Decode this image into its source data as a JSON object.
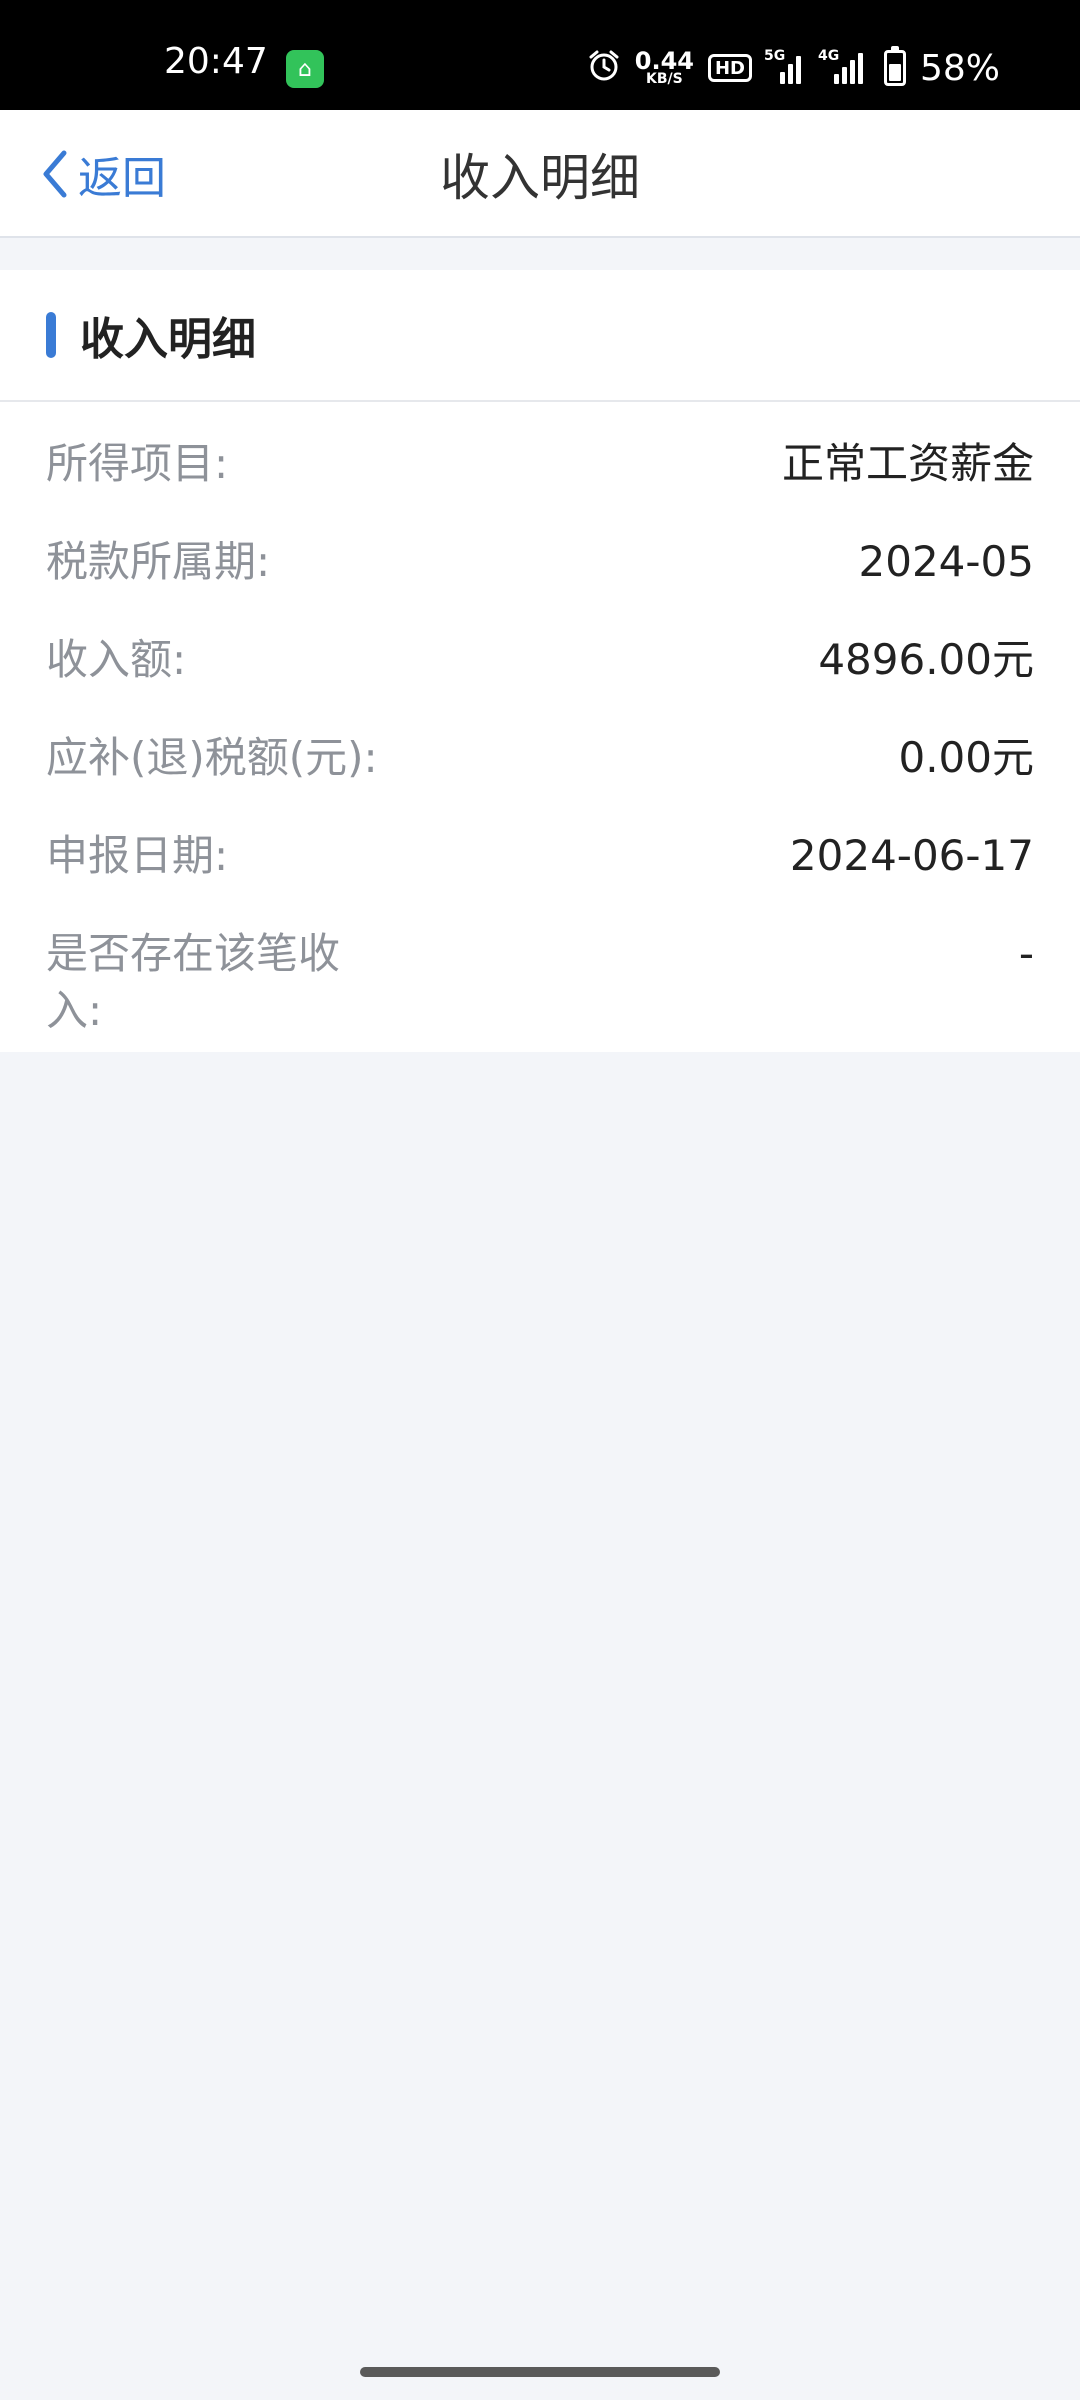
{
  "status_bar": {
    "time": "20:47",
    "net_speed_value": "0.44",
    "net_speed_unit": "KB/S",
    "hd_label": "HD",
    "signal1_label": "5G",
    "signal2_label": "4G",
    "battery": "58%",
    "battery_level": 0.58,
    "icons": [
      "alarm-icon",
      "hd-icon",
      "signal-5g-icon",
      "signal-4g-icon",
      "battery-icon"
    ]
  },
  "nav": {
    "back_label": "返回",
    "title": "收入明细"
  },
  "card": {
    "title": "收入明细",
    "rows": [
      {
        "label": "所得项目:",
        "value": "正常工资薪金"
      },
      {
        "label": "税款所属期:",
        "value": "2024-05"
      },
      {
        "label": "收入额:",
        "value": "4896.00元"
      },
      {
        "label": "应补(退)税额(元):",
        "value": "0.00元"
      },
      {
        "label": "申报日期:",
        "value": "2024-06-17"
      },
      {
        "label": "是否存在该笔收入:",
        "value": "-"
      }
    ]
  },
  "colors": {
    "accent": "#3a7bd5",
    "background": "#f3f5f9",
    "label": "#8e9299",
    "value": "#222222"
  }
}
